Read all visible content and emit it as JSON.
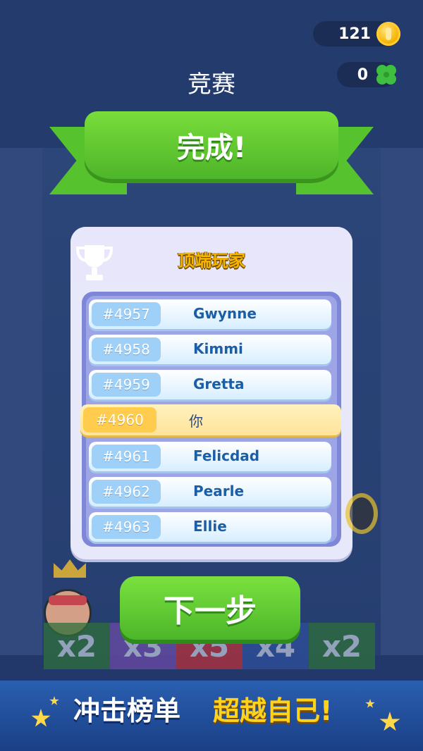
{
  "hud": {
    "coins": "121",
    "clovers": "0",
    "coin_icon": "gold-coin-icon",
    "clover_icon": "four-leaf-clover-icon"
  },
  "screen": {
    "title": "竞赛"
  },
  "ribbon": {
    "label": "完成!"
  },
  "leaderboard": {
    "title": "顶端玩家",
    "trophy_icon": "trophy-icon",
    "rows": [
      {
        "rank": "#4957",
        "name": "Gwynne"
      },
      {
        "rank": "#4958",
        "name": "Kimmi"
      },
      {
        "rank": "#4959",
        "name": "Gretta"
      },
      {
        "rank": "#4960",
        "name": "你",
        "highlight": true
      },
      {
        "rank": "#4961",
        "name": "Felicdad"
      },
      {
        "rank": "#4962",
        "name": "Pearle"
      },
      {
        "rank": "#4963",
        "name": "Ellie"
      }
    ]
  },
  "board": {
    "multipliers": [
      "x2",
      "x3",
      "x5",
      "x4",
      "x2"
    ]
  },
  "next_button": {
    "label": "下一步"
  },
  "promo_banner": {
    "part1": "冲击榜单",
    "part2": "超越自己!"
  },
  "colors": {
    "accent_green": "#56c22e",
    "gold": "#f5b400",
    "highlight_row": "#ffe39a"
  }
}
